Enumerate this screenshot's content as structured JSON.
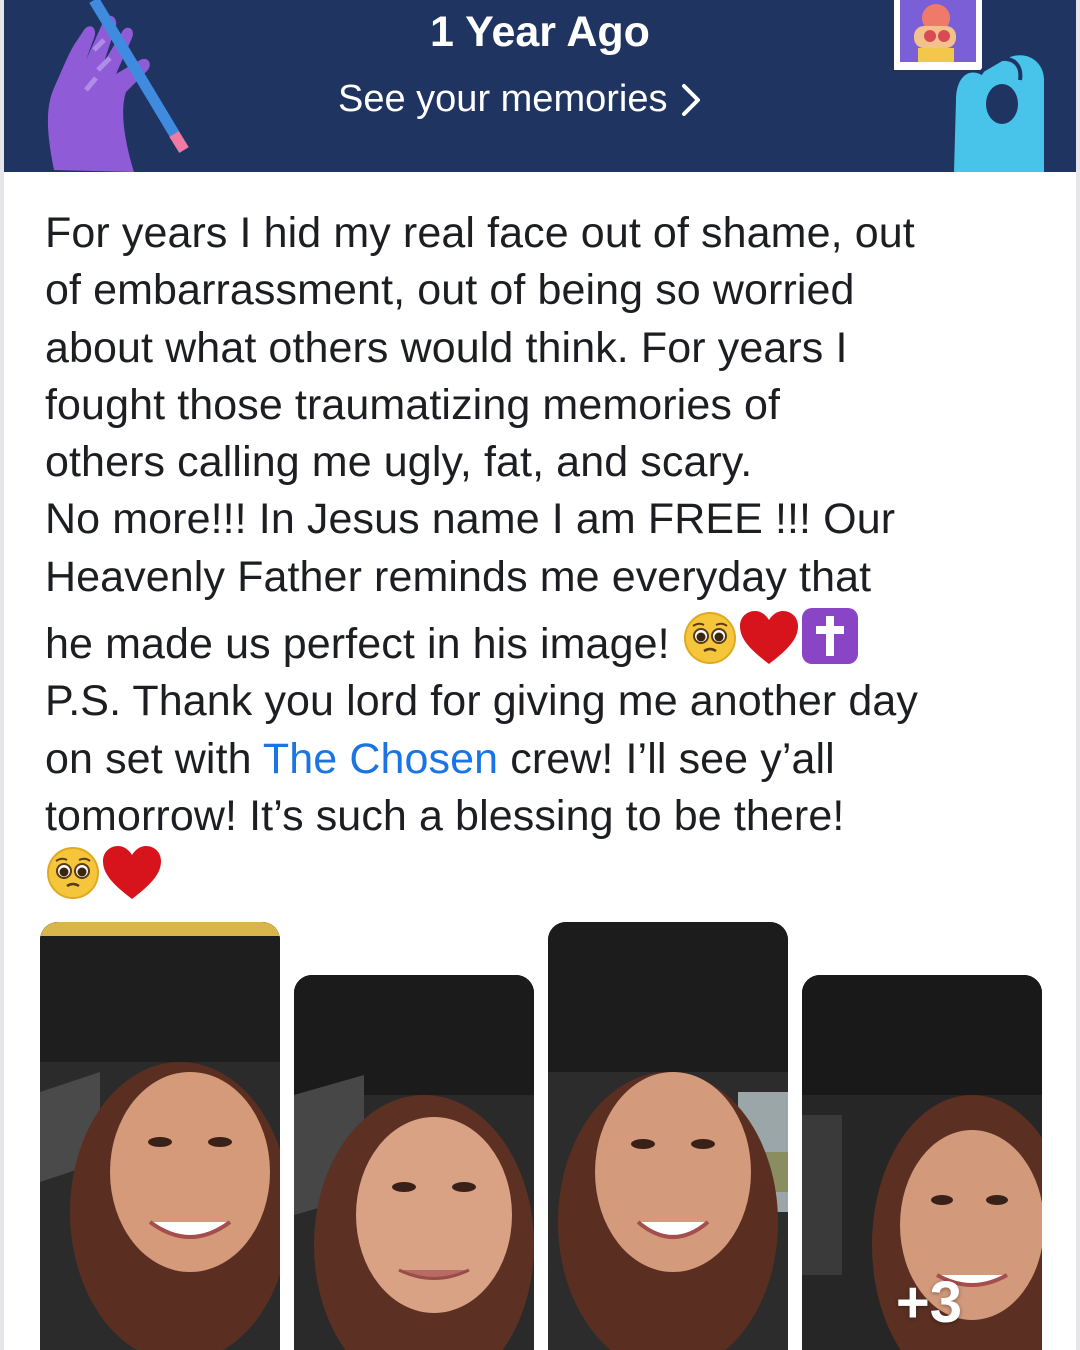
{
  "banner": {
    "title": "1 Year Ago",
    "link_label": "See your memories",
    "background": "#1f3461",
    "link_icon": "chevron-right-icon"
  },
  "post": {
    "text_before_tag": "For years I hid my real face out of shame, out\nof embarrassment, out of being so worried\nabout what others would think. For years I\nfought those traumatizing memories of\nothers calling me ugly, fat, and scary.\nNo more!!! In Jesus name I am FREE !!! Our\nHeavenly Father reminds me everyday that\nhe made us perfect in his image! ",
    "line_ps_start": "\nP.S. Thank you lord for giving me another day\non set with ",
    "tag": "The Chosen",
    "text_after_tag": " crew! I’ll see y’all\ntomorrow! It’s such a blessing to be there!\n",
    "tag_color": "#1b74e4",
    "emojis_line1": [
      "pleading-face-emoji",
      "red-heart-emoji",
      "latin-cross-emoji"
    ],
    "emojis_end": [
      "pleading-face-emoji",
      "red-heart-emoji"
    ]
  },
  "photos": {
    "items": [
      "selfie-photo-1",
      "selfie-photo-2",
      "selfie-photo-3",
      "selfie-photo-4"
    ],
    "more_count": "+3"
  }
}
